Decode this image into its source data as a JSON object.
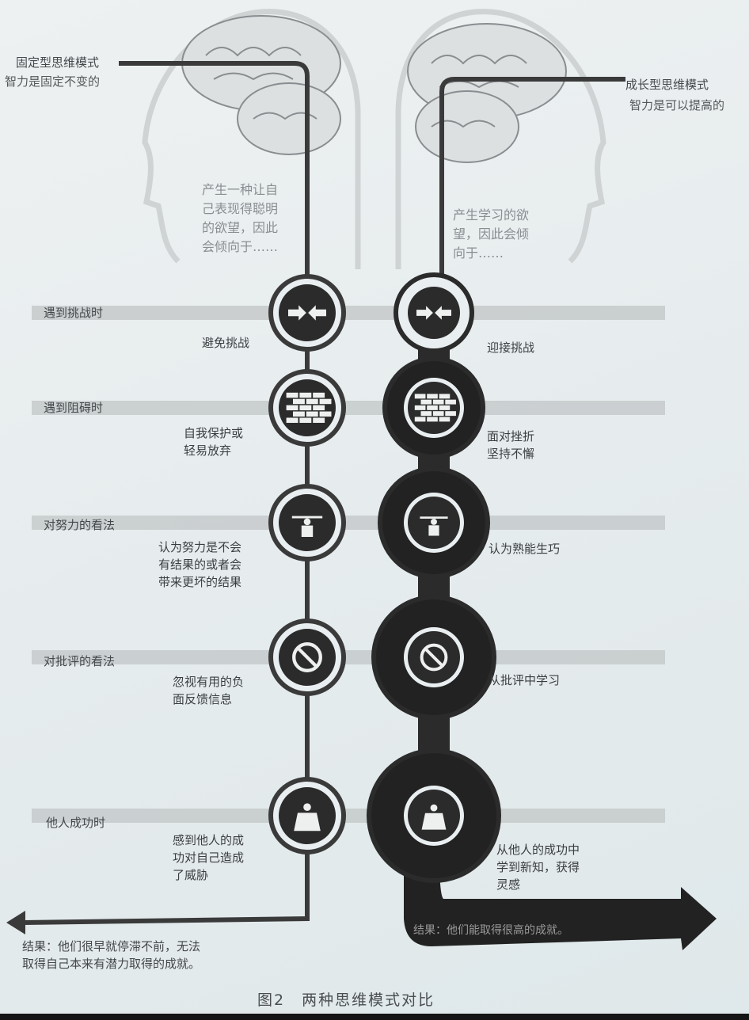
{
  "fixed": {
    "title": "固定型思维模式",
    "subtitle": "智力是固定不变的",
    "desire": [
      "产生一种让自",
      "己表现得聪明",
      "的欲望，因此",
      "会倾向于……"
    ],
    "responses": [
      [
        "避免挑战"
      ],
      [
        "自我保护或",
        "轻易放弃"
      ],
      [
        "认为努力是不会",
        "有结果的或者会",
        "带来更坏的结果"
      ],
      [
        "忽视有用的负",
        "面反馈信息"
      ],
      [
        "感到他人的成",
        "功对自己造成",
        "了威胁"
      ]
    ],
    "result": [
      "结果：他们很早就停滞不前，无法",
      "取得自己本来有潜力取得的成就。"
    ]
  },
  "growth": {
    "title": "成长型思维模式",
    "subtitle": "智力是可以提高的",
    "desire": [
      "产生学习的欲",
      "望，因此会倾",
      "向于……"
    ],
    "responses": [
      [
        "迎接挑战"
      ],
      [
        "面对挫折",
        "坚持不懈"
      ],
      [
        "认为熟能生巧"
      ],
      [
        "从批评中学习"
      ],
      [
        "从他人的成功中",
        "学到新知，获得",
        "灵感"
      ]
    ],
    "result": "结果：他们能取得很高的成就。"
  },
  "situations": [
    "遇到挑战时",
    "遇到阻碍时",
    "对努力的看法",
    "对批评的看法",
    "他人成功时"
  ],
  "icons": [
    "arrows-inward-icon",
    "brick-wall-icon",
    "weightlifter-icon",
    "prohibited-icon",
    "people-icon"
  ],
  "caption": "图2　两种思维模式对比",
  "colors": {
    "line": "#3a3a3a",
    "band": "#c9cccd",
    "circle": "#2b2b2b",
    "head": "#cfd3d4"
  }
}
